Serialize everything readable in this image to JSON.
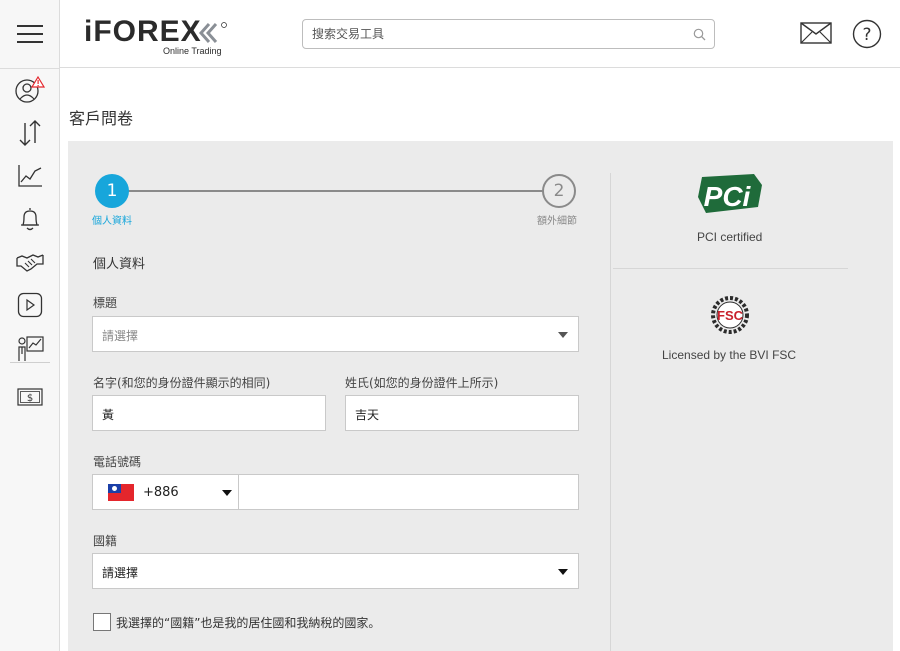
{
  "header": {
    "logo_text": "iFOREX",
    "logo_tagline": "Online Trading",
    "search_placeholder": "搜索交易工具"
  },
  "sidebar": {
    "items": [
      {
        "icon": "user-alert-icon"
      },
      {
        "icon": "trade-arrows-icon"
      },
      {
        "icon": "chart-icon"
      },
      {
        "icon": "bell-icon"
      },
      {
        "icon": "handshake-icon"
      },
      {
        "icon": "play-video-icon"
      },
      {
        "icon": "investor-chart-icon"
      },
      {
        "icon": "dollar-bill-icon"
      }
    ]
  },
  "page": {
    "title": "客戶問卷"
  },
  "stepper": {
    "step1_number": "1",
    "step1_label": "個人資料",
    "step2_number": "2",
    "step2_label": "額外細節"
  },
  "form": {
    "section_title": "個人資料",
    "title_label": "標題",
    "title_placeholder": "請選擇",
    "first_name_label": "名字(和您的身份證件顯示的相同)",
    "first_name_value": "黃",
    "last_name_label": "姓氏(如您的身份證件上所示)",
    "last_name_value": "吉天",
    "phone_label": "電話號碼",
    "phone_country_code": "+886",
    "phone_value": "",
    "nationality_label": "國籍",
    "nationality_value": "請選擇",
    "residence_checkbox_label": "我選擇的“國籍”也是我的居住國和我納稅的國家。"
  },
  "badges": {
    "pci_logo_text": "PCi",
    "pci_caption": "PCI certified",
    "fsc_logo_text": "FSC",
    "fsc_caption": "Licensed by the BVI FSC"
  },
  "colors": {
    "accent": "#17a6db",
    "panel_bg": "#ebebeb",
    "pci_green": "#1f6b3a",
    "fsc_red": "#c8202c"
  }
}
